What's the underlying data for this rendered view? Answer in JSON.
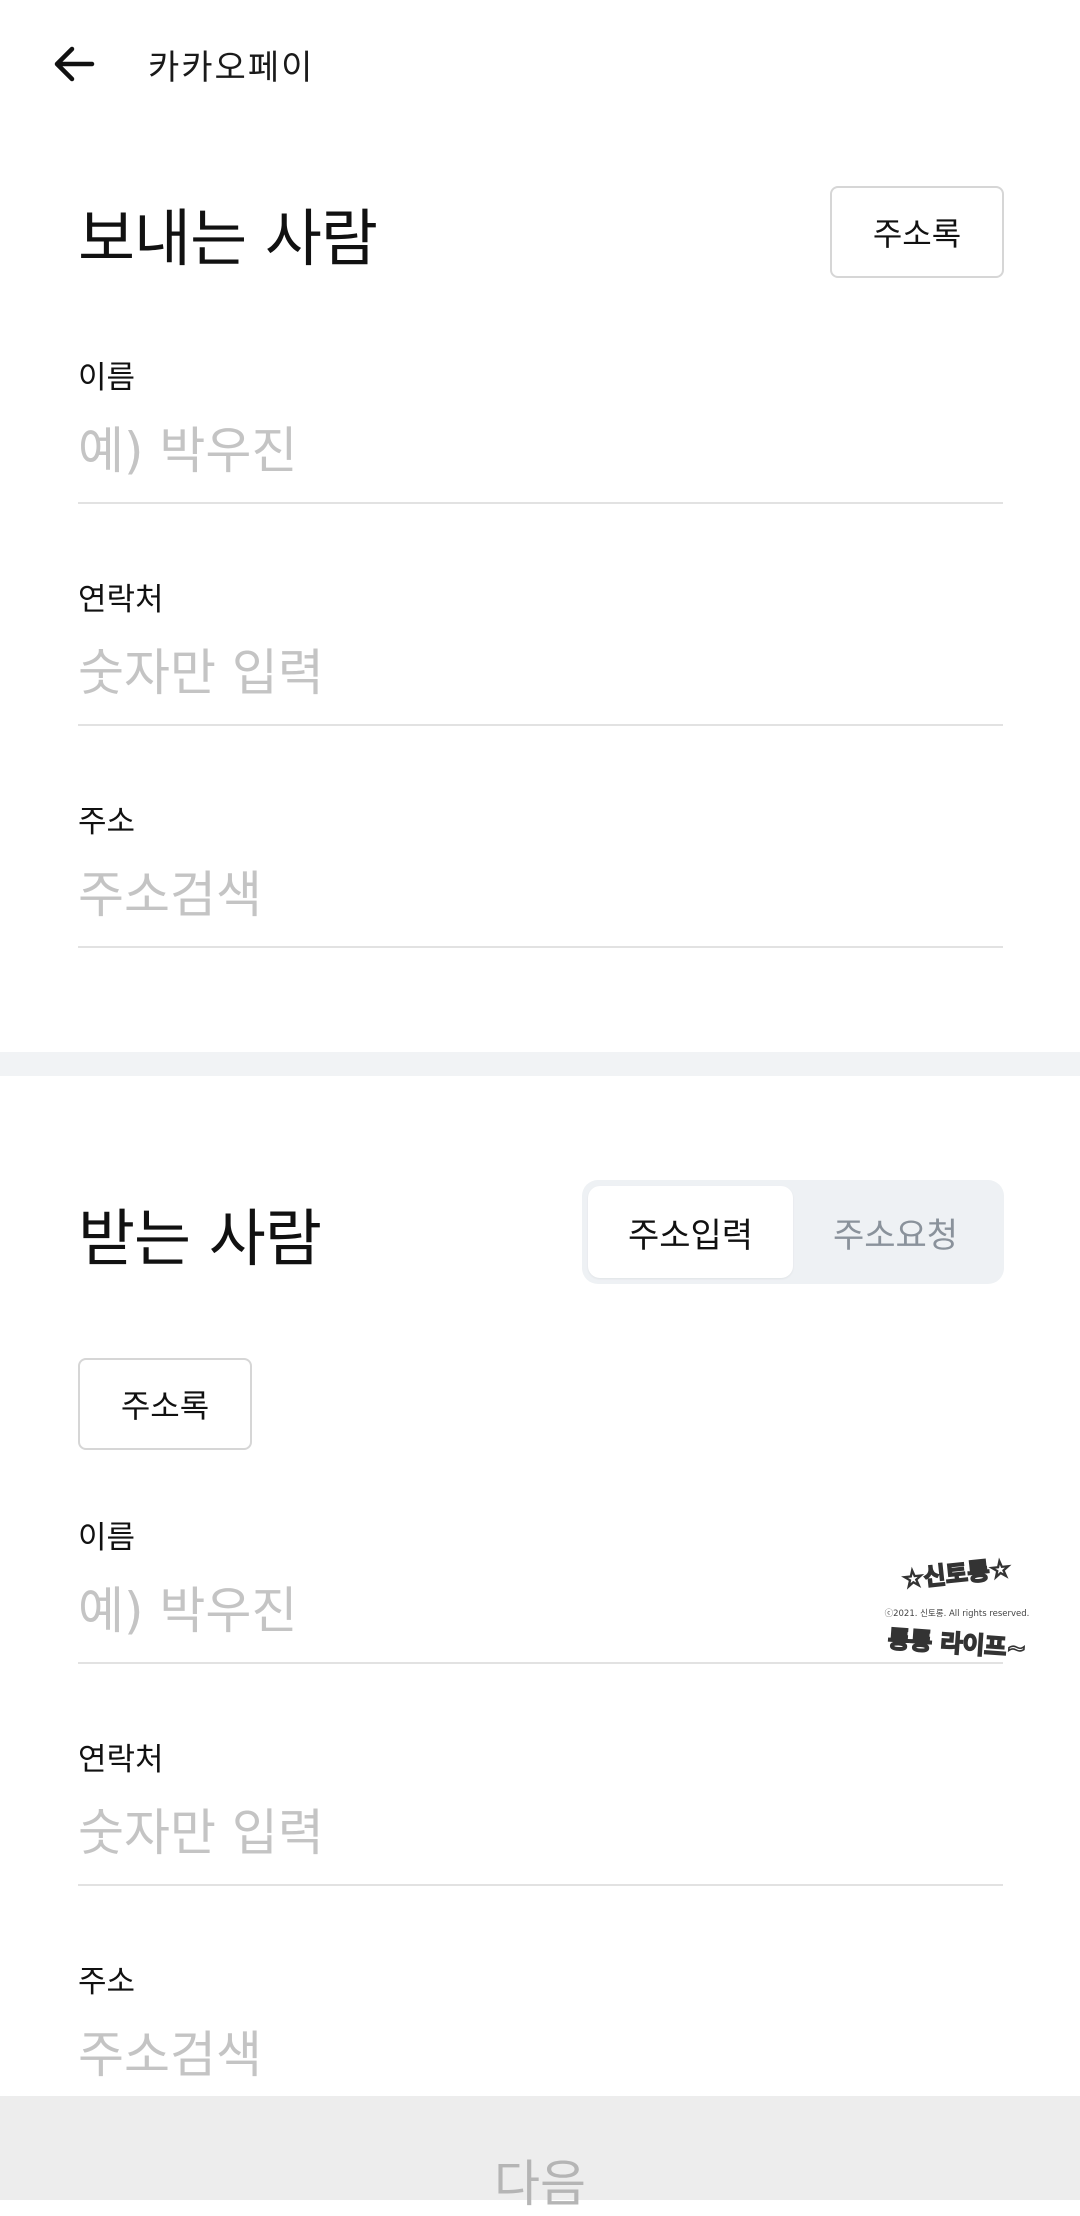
{
  "header": {
    "back_icon": "arrow-left-icon",
    "logo_text": "카카오페이"
  },
  "sender": {
    "title": "보내는 사람",
    "address_book_label": "주소록",
    "fields": [
      {
        "label": "이름",
        "placeholder": "예) 박우진",
        "value": ""
      },
      {
        "label": "연락처",
        "placeholder": "숫자만 입력",
        "value": ""
      },
      {
        "label": "주소",
        "placeholder": "주소검색",
        "value": ""
      }
    ]
  },
  "receiver": {
    "title": "받는 사람",
    "segments": [
      {
        "label": "주소입력",
        "selected": true
      },
      {
        "label": "주소요청",
        "selected": false
      }
    ],
    "address_book_label": "주소록",
    "fields": [
      {
        "label": "이름",
        "placeholder": "예) 박우진",
        "value": ""
      },
      {
        "label": "연락처",
        "placeholder": "숫자만 입력",
        "value": ""
      },
      {
        "label": "주소",
        "placeholder": "주소검색",
        "value": ""
      }
    ]
  },
  "watermark": {
    "line1": "☆신토롱☆",
    "line2": "ⓒ2021. 신토롱. All rights reserved.",
    "line3": "통통 라이프~"
  },
  "footer": {
    "next_label": "다음",
    "enabled": false
  },
  "colors": {
    "placeholder": "#c4c4c4",
    "divider": "#e2e2e2",
    "section_band": "#f1f3f5",
    "segment_bg": "#eef1f4",
    "disabled_bar": "#ededed",
    "disabled_text": "#b5b5b5"
  }
}
